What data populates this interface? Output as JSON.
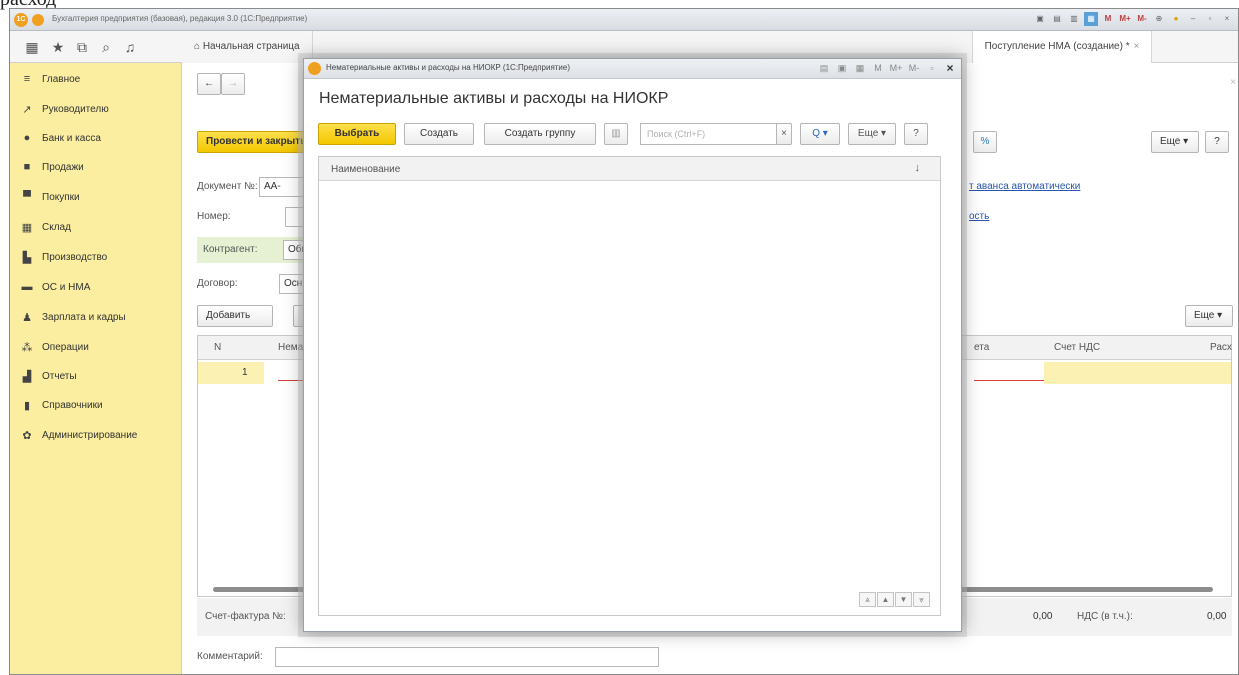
{
  "top_fragment": "расход",
  "app": {
    "title": "Бухгалтерия предприятия (базовая), редакция 3.0  (1С:Предприятие)",
    "toolbar_marks": [
      "M",
      "M+",
      "M-"
    ]
  },
  "tabs": [
    {
      "label": "Начальная страница"
    },
    {
      "label": "Поступление НМА (создание) *",
      "close": "×"
    }
  ],
  "sidebar": {
    "items": [
      {
        "label": "Главное",
        "icon": "menu-icon",
        "glyph": "≡"
      },
      {
        "label": "Руководителю",
        "icon": "chart-trend-icon",
        "glyph": "↗"
      },
      {
        "label": "Банк и касса",
        "icon": "coins-icon",
        "glyph": "●"
      },
      {
        "label": "Продажи",
        "icon": "bag-icon",
        "glyph": "■"
      },
      {
        "label": "Покупки",
        "icon": "cart-icon",
        "glyph": "▀"
      },
      {
        "label": "Склад",
        "icon": "warehouse-icon",
        "glyph": "▦"
      },
      {
        "label": "Производство",
        "icon": "factory-icon",
        "glyph": "▙"
      },
      {
        "label": "ОС и НМА",
        "icon": "truck-icon",
        "glyph": "▬"
      },
      {
        "label": "Зарплата и кадры",
        "icon": "person-icon",
        "glyph": "♟"
      },
      {
        "label": "Операции",
        "icon": "operations-icon",
        "glyph": "⁂"
      },
      {
        "label": "Отчеты",
        "icon": "bar-chart-icon",
        "glyph": "▟"
      },
      {
        "label": "Справочники",
        "icon": "book-icon",
        "glyph": "▮"
      },
      {
        "label": "Администрирование",
        "icon": "gear-icon",
        "glyph": "✿"
      }
    ]
  },
  "doc": {
    "post_close_button": "Провести и закрыть",
    "doc_number_label": "Документ №:",
    "doc_number_value": "АА-",
    "number_label": "Номер:",
    "counterparty_label": "Контрагент:",
    "counterparty_value": "Общ",
    "contract_label": "Договор:",
    "contract_value": "Осн",
    "add_button": "Добавить",
    "more_top": "Еще",
    "more_table": "Еще",
    "help": "?",
    "advance_link": "т аванса автоматически",
    "link2": "ость",
    "grid": {
      "headers": [
        "N",
        "Немат",
        "ета",
        "Счет НДС",
        "Расх"
      ],
      "row1_n": "1"
    },
    "invoice_label": "Счет-фактура №:",
    "total_value": "0,00",
    "vat_label": "НДС (в т.ч.):",
    "vat_value": "0,00",
    "comment_label": "Комментарий:"
  },
  "modal": {
    "window_title": "Нематериальные активы и расходы на НИОКР  (1С:Предприятие)",
    "heading": "Нематериальные активы и расходы на НИОКР",
    "select_button": "Выбрать",
    "create_button": "Создать",
    "create_group_button": "Создать группу",
    "search_placeholder": "Поиск (Ctrl+F)",
    "search_clear": "×",
    "search_btn": "Q ▾",
    "more_button": "Еще ▾",
    "help_button": "?",
    "column_name": "Наименование",
    "sort_indicator": "↓",
    "nav": [
      "⩓",
      "▲",
      "▼",
      "⩔"
    ]
  }
}
